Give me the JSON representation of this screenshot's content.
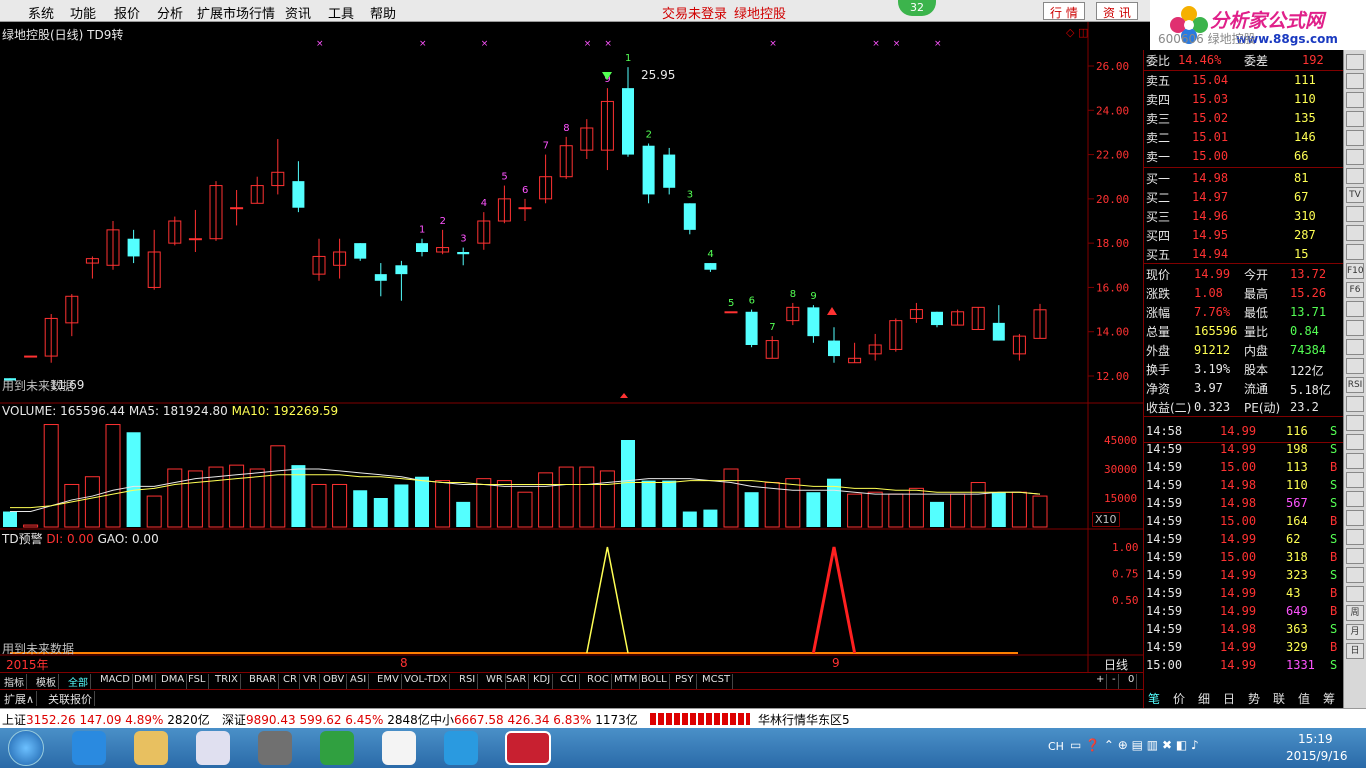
{
  "menu": {
    "items": [
      "系统",
      "功能",
      "报价",
      "分析",
      "扩展市场行情",
      "资讯",
      "工具",
      "帮助"
    ],
    "notice1": "交易未登录",
    "notice2": "绿地控股",
    "badge": "32",
    "btn_quote": "行 情",
    "btn_info": "资 讯",
    "logo": "分析家公式网",
    "logo_url": "www.88gs.com"
  },
  "chart": {
    "title": "绿地控股(日线) TD9转",
    "high_label": "25.95",
    "low_label": "11.69",
    "future_label": "用到未来数据",
    "price_ticks": [
      "26.00",
      "24.00",
      "22.00",
      "20.00",
      "18.00",
      "16.00",
      "14.00",
      "12.00"
    ],
    "volume_header": {
      "label": "VOLUME: 165596.44",
      "ma5": "MA5: 181924.80",
      "ma10": "MA10: 192269.59"
    },
    "volume_ticks": [
      "45000",
      "30000",
      "15000"
    ],
    "volume_unit": "X10",
    "ind_header": {
      "name": "TD预警",
      "di": "DI: 0.00",
      "gao": "GAO: 0.00"
    },
    "ind_ticks": [
      "1.00",
      "0.75",
      "0.50"
    ],
    "ind_future": "用到未来数据",
    "date_labels": {
      "year": "2015年",
      "m8": "8",
      "m9": "9",
      "period": "日线"
    }
  },
  "chart_data": {
    "type": "candlestick",
    "candles": [
      [
        11.9,
        11.8,
        11.9,
        11.8
      ],
      [
        12.9,
        12.9,
        12.9,
        12.9
      ],
      [
        12.9,
        14.6,
        14.8,
        12.6
      ],
      [
        14.4,
        15.6,
        15.7,
        13.8
      ],
      [
        17.1,
        17.3,
        17.4,
        16.4
      ],
      [
        17.0,
        18.6,
        19.0,
        16.8
      ],
      [
        18.2,
        17.4,
        18.6,
        17.1
      ],
      [
        16.0,
        17.6,
        18.6,
        15.9
      ],
      [
        18.0,
        19.0,
        19.2,
        17.9
      ],
      [
        18.2,
        18.2,
        19.5,
        17.6
      ],
      [
        18.2,
        20.6,
        20.8,
        18.1
      ],
      [
        19.6,
        19.6,
        20.4,
        18.8
      ],
      [
        19.8,
        20.6,
        21.0,
        19.8
      ],
      [
        20.6,
        21.2,
        22.7,
        20.2
      ],
      [
        20.8,
        19.6,
        21.7,
        19.4
      ],
      [
        16.6,
        17.4,
        18.2,
        16.3
      ],
      [
        17.0,
        17.6,
        18.2,
        16.4
      ],
      [
        18.0,
        17.3,
        18.0,
        17.2
      ],
      [
        16.6,
        16.3,
        17.1,
        15.6
      ],
      [
        17.0,
        16.6,
        17.2,
        15.4
      ],
      [
        18.0,
        17.6,
        18.2,
        17.4
      ],
      [
        17.6,
        17.8,
        18.6,
        17.5
      ],
      [
        17.6,
        17.5,
        17.8,
        17.0
      ],
      [
        18.0,
        19.0,
        19.4,
        17.7
      ],
      [
        19.0,
        20.0,
        20.6,
        18.9
      ],
      [
        19.6,
        19.6,
        20.0,
        19.0
      ],
      [
        20.0,
        21.0,
        22.0,
        19.8
      ],
      [
        21.0,
        22.4,
        22.8,
        20.9
      ],
      [
        22.2,
        23.2,
        23.6,
        21.8
      ],
      [
        22.2,
        24.4,
        25.0,
        21.3
      ],
      [
        25.0,
        22.0,
        25.95,
        21.9
      ],
      [
        22.4,
        20.2,
        22.5,
        19.8
      ],
      [
        22.0,
        20.5,
        22.3,
        20.2
      ],
      [
        19.8,
        18.6,
        19.8,
        18.4
      ],
      [
        17.1,
        16.8,
        17.1,
        16.7
      ],
      [
        14.9,
        14.9,
        14.9,
        14.9
      ],
      [
        14.9,
        13.4,
        15.0,
        13.3
      ],
      [
        12.8,
        13.6,
        13.8,
        12.8
      ],
      [
        14.5,
        15.1,
        15.3,
        14.3
      ],
      [
        15.1,
        13.8,
        15.2,
        13.5
      ],
      [
        13.6,
        12.9,
        14.2,
        12.6
      ],
      [
        12.6,
        12.8,
        13.5,
        12.6
      ],
      [
        13.0,
        13.4,
        13.9,
        12.7
      ],
      [
        13.2,
        14.5,
        14.6,
        13.1
      ],
      [
        14.6,
        15.0,
        15.3,
        14.4
      ],
      [
        14.9,
        14.3,
        14.9,
        14.2
      ],
      [
        14.3,
        14.9,
        15.0,
        14.3
      ],
      [
        14.1,
        15.1,
        15.1,
        14.1
      ],
      [
        14.4,
        13.6,
        15.2,
        13.6
      ],
      [
        13.0,
        13.8,
        13.9,
        12.7
      ],
      [
        13.7,
        14.99,
        15.26,
        13.71
      ]
    ],
    "volume": [
      8,
      1,
      53,
      22,
      26,
      53,
      49,
      16,
      30,
      29,
      31,
      32,
      30,
      42,
      32,
      22,
      22,
      19,
      15,
      22,
      26,
      24,
      13,
      25,
      24,
      18,
      28,
      31,
      31,
      29,
      45,
      24,
      24,
      8,
      9,
      30,
      18,
      23,
      25,
      18,
      25,
      17,
      18,
      17,
      20,
      13,
      17,
      23,
      18,
      18,
      16
    ],
    "ma5": [
      8,
      8,
      11,
      14,
      16,
      19,
      21,
      21,
      23,
      25,
      26,
      27,
      28,
      29,
      30,
      30,
      29,
      28,
      27,
      26,
      24,
      23,
      22,
      22,
      21,
      21,
      21,
      22,
      22,
      23,
      24,
      25,
      25,
      25,
      24,
      23,
      21,
      20,
      19,
      19,
      19,
      18,
      17,
      17,
      17,
      17,
      17,
      17,
      18,
      18,
      17
    ],
    "ma10": [
      10,
      10,
      11,
      13,
      15,
      17,
      19,
      20,
      22,
      23,
      24,
      25,
      26,
      27,
      27,
      27,
      27,
      26,
      26,
      25,
      24,
      23,
      23,
      22,
      22,
      22,
      22,
      22,
      22,
      22,
      23,
      23,
      23,
      24,
      24,
      24,
      24,
      23,
      22,
      21,
      21,
      20,
      20,
      19,
      19,
      18,
      18,
      18,
      18,
      18,
      17
    ],
    "td_seq": {
      "29": "9",
      "30": "1",
      "31": "2",
      "33": "3",
      "34": "4",
      "35": "5",
      "36": "6",
      "37": "7",
      "38": "8",
      "39": "9",
      "20": "1",
      "21": "2",
      "22": "3",
      "23": "4",
      "24": "5",
      "25": "6",
      "26": "7",
      "27": "8"
    },
    "td_signal": [
      {
        "center": 29,
        "value": 1.0,
        "color": "#ffff54"
      },
      {
        "center": 40,
        "value": 1.0,
        "color": "#ff2020"
      }
    ]
  },
  "quote": {
    "code": "600606",
    "name": "绿地控股",
    "weibi_label": "委比",
    "weibi": "14.46%",
    "weicha_label": "委差",
    "weicha": "192",
    "asks": [
      {
        "l": "卖五",
        "p": "15.04",
        "v": "111"
      },
      {
        "l": "卖四",
        "p": "15.03",
        "v": "110"
      },
      {
        "l": "卖三",
        "p": "15.02",
        "v": "135"
      },
      {
        "l": "卖二",
        "p": "15.01",
        "v": "146"
      },
      {
        "l": "卖一",
        "p": "15.00",
        "v": "66"
      }
    ],
    "bids": [
      {
        "l": "买一",
        "p": "14.98",
        "v": "81"
      },
      {
        "l": "买二",
        "p": "14.97",
        "v": "67"
      },
      {
        "l": "买三",
        "p": "14.96",
        "v": "310"
      },
      {
        "l": "买四",
        "p": "14.95",
        "v": "287"
      },
      {
        "l": "买五",
        "p": "14.94",
        "v": "15"
      }
    ],
    "stats": [
      [
        "现价",
        "14.99",
        "今开",
        "13.72"
      ],
      [
        "涨跌",
        "1.08",
        "最高",
        "15.26"
      ],
      [
        "涨幅",
        "7.76%",
        "最低",
        "13.71"
      ],
      [
        "总量",
        "165596",
        "量比",
        "0.84"
      ],
      [
        "外盘",
        "91212",
        "内盘",
        "74384"
      ],
      [
        "换手",
        "3.19%",
        "股本",
        "122亿"
      ],
      [
        "净资",
        "3.97",
        "流通",
        "5.18亿"
      ],
      [
        "收益(二)",
        "0.323",
        "PE(动)",
        "23.2"
      ]
    ],
    "ticks": [
      [
        "14:58",
        "14.99",
        "116",
        "S"
      ],
      [
        "14:59",
        "14.99",
        "198",
        "S"
      ],
      [
        "14:59",
        "15.00",
        "113",
        "B"
      ],
      [
        "14:59",
        "14.98",
        "110",
        "S"
      ],
      [
        "14:59",
        "14.98",
        "567",
        "S"
      ],
      [
        "14:59",
        "15.00",
        "164",
        "B"
      ],
      [
        "14:59",
        "14.99",
        "62",
        "S"
      ],
      [
        "14:59",
        "15.00",
        "318",
        "B"
      ],
      [
        "14:59",
        "14.99",
        "323",
        "S"
      ],
      [
        "14:59",
        "14.99",
        "43",
        "B"
      ],
      [
        "14:59",
        "14.99",
        "649",
        "B"
      ],
      [
        "14:59",
        "14.98",
        "363",
        "S"
      ],
      [
        "14:59",
        "14.99",
        "329",
        "B"
      ],
      [
        "15:00",
        "14.99",
        "1331",
        "S"
      ]
    ],
    "bottom_tabs": [
      "笔",
      "价",
      "细",
      "日",
      "势",
      "联",
      "值",
      "筹"
    ]
  },
  "tabs": [
    "指标",
    "模板",
    "全部",
    "MACD",
    "DMI",
    "DMA",
    "FSL",
    "TRIX",
    "BRAR",
    "CR",
    "VR",
    "OBV",
    "ASI",
    "EMV",
    "VOL-TDX",
    "RSI",
    "WR",
    "SAR",
    "KDJ",
    "CCI",
    "ROC",
    "MTM",
    "BOLL",
    "PSY",
    "MCST"
  ],
  "tabs2": [
    "扩展∧",
    "关联报价"
  ],
  "tabctl": [
    "+",
    "-",
    "0"
  ],
  "status": {
    "sh_label": "上证",
    "sh": "3152.26",
    "sh_chg": "147.09",
    "sh_pct": "4.89%",
    "sh_amt": "2820亿",
    "sz_label": "深证",
    "sz": "9890.43",
    "sz_chg": "599.62",
    "sz_pct": "6.45%",
    "sz_amt": "2848亿",
    "zx_label": "中小",
    "zx": "6667.58",
    "zx_chg": "426.34",
    "zx_pct": "6.83%",
    "zx_amt": "1173亿",
    "server": "华林行情华东区5"
  },
  "taskbar": {
    "lang": "CH",
    "time": "15:19",
    "date": "2015/9/16"
  },
  "side_icons": [
    "RSI",
    "F10",
    "F6",
    "日",
    "周",
    "月",
    "TV"
  ]
}
